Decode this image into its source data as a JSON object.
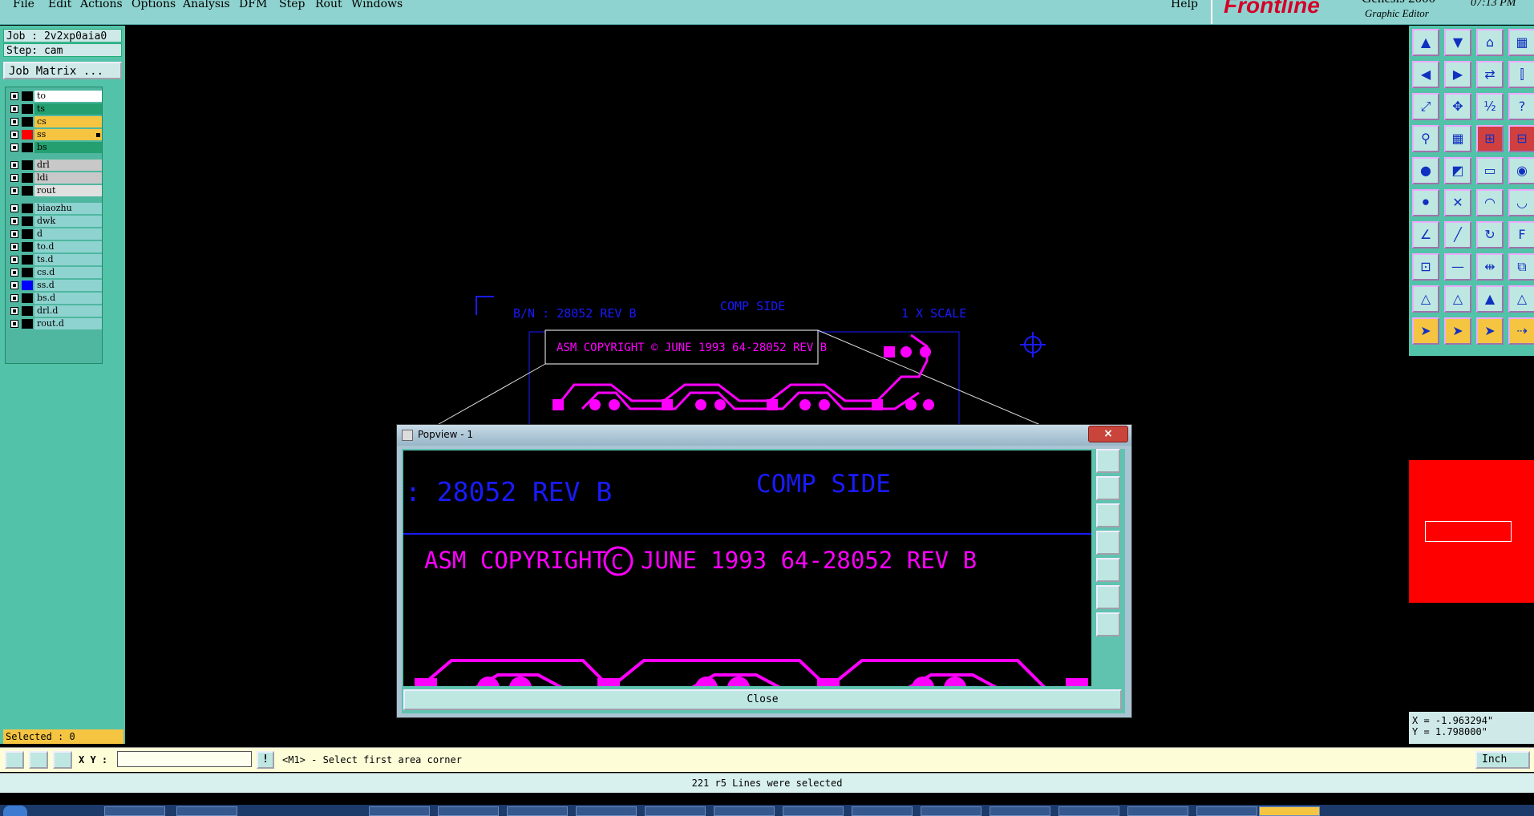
{
  "menu": {
    "items": [
      "File",
      "Edit",
      "Actions",
      "Options",
      "Analysis",
      "DFM",
      "Step",
      "Rout",
      "Windows"
    ],
    "help": "Help"
  },
  "brand": {
    "logo": "Frontline",
    "product": "Genesis 2000",
    "subtitle": "Graphic Editor",
    "clock": "07:13 PM"
  },
  "job": {
    "job_label": "Job : 2v2xp0aia0",
    "step_label": "Step: cam",
    "matrix_button": "Job Matrix ..."
  },
  "layers": [
    {
      "name": "to",
      "color": "#ffffff",
      "swatch": "#000000"
    },
    {
      "name": "ts",
      "color": "#24a070",
      "swatch": "#000000"
    },
    {
      "name": "cs",
      "color": "#f5c542",
      "swatch": "#000000"
    },
    {
      "name": "ss",
      "color": "#f5c542",
      "swatch": "#ff0000",
      "active": true
    },
    {
      "name": "bs",
      "color": "#24a070",
      "swatch": "#000000"
    },
    {
      "name": "drl",
      "color": "#c8c8c8",
      "swatch": "#000000"
    },
    {
      "name": "ldi",
      "color": "#c8c8c8",
      "swatch": "#000000"
    },
    {
      "name": "rout",
      "color": "#e0e0e0",
      "swatch": "#000000"
    },
    {
      "name": "biaozhu",
      "color": "#8ed3cf",
      "swatch": "#000000"
    },
    {
      "name": "dwk",
      "color": "#8ed3cf",
      "swatch": "#000000"
    },
    {
      "name": "d",
      "color": "#8ed3cf",
      "swatch": "#000000"
    },
    {
      "name": "to.d",
      "color": "#8ed3cf",
      "swatch": "#000000"
    },
    {
      "name": "ts.d",
      "color": "#8ed3cf",
      "swatch": "#000000"
    },
    {
      "name": "cs.d",
      "color": "#8ed3cf",
      "swatch": "#000000"
    },
    {
      "name": "ss.d",
      "color": "#8ed3cf",
      "swatch": "#0000ff"
    },
    {
      "name": "bs.d",
      "color": "#8ed3cf",
      "swatch": "#000000"
    },
    {
      "name": "drl.d",
      "color": "#8ed3cf",
      "swatch": "#000000"
    },
    {
      "name": "rout.d",
      "color": "#8ed3cf",
      "swatch": "#000000"
    }
  ],
  "selected_label": "Selected : 0",
  "canvas": {
    "pn_text": "B/N : 28052 REV B",
    "side_text": "COMP SIDE",
    "scale_text": "1 X SCALE",
    "copyright_text": "ASM COPYRIGHT © JUNE 1993 64-28052 REV B",
    "magenta": "#ff00ff",
    "blue": "#1a1aff"
  },
  "popview": {
    "title": "Popview - 1",
    "close_x": "×",
    "pn_text": ": 28052 REV B",
    "side_text": "COMP SIDE",
    "copyright_prefix": "ASM COPYRIGHT",
    "copyright_symbol": "C",
    "copyright_suffix": "JUNE 1993 64-28052 REV B",
    "close_button": "Close"
  },
  "coords": {
    "x": "X = -1.963294\"",
    "y": "Y = 1.798000\""
  },
  "command": {
    "xy_label": "X Y :",
    "xy_value": "",
    "prompt": "<M1> - Select first area corner",
    "units": "Inch"
  },
  "status": "221 r5 Lines were selected",
  "tools": [
    "upload-icon",
    "download-icon",
    "home-icon",
    "window-icon",
    "step-left-icon",
    "step-right-icon",
    "swap-icon",
    "split-icon",
    "fit-icon",
    "center-icon",
    "ratio-icon",
    "help-icon",
    "probe-icon",
    "grid-icon",
    "net-icon",
    "net-alt-icon",
    "pad-icon",
    "line-icon",
    "ruler-icon",
    "dot-icon",
    "connect-icon",
    "cross-icon",
    "arc-icon",
    "arc-alt-icon",
    "angle-icon",
    "diag-icon",
    "rotate-icon",
    "text-icon",
    "move-icon",
    "dash-icon",
    "align-icon",
    "link-icon",
    "triangle-icon",
    "triangle-alt-icon",
    "triangle-bold-icon",
    "triangle-line-icon",
    "pointer-icon",
    "pointer-alt-icon",
    "pointer-bold-icon",
    "route-icon"
  ]
}
